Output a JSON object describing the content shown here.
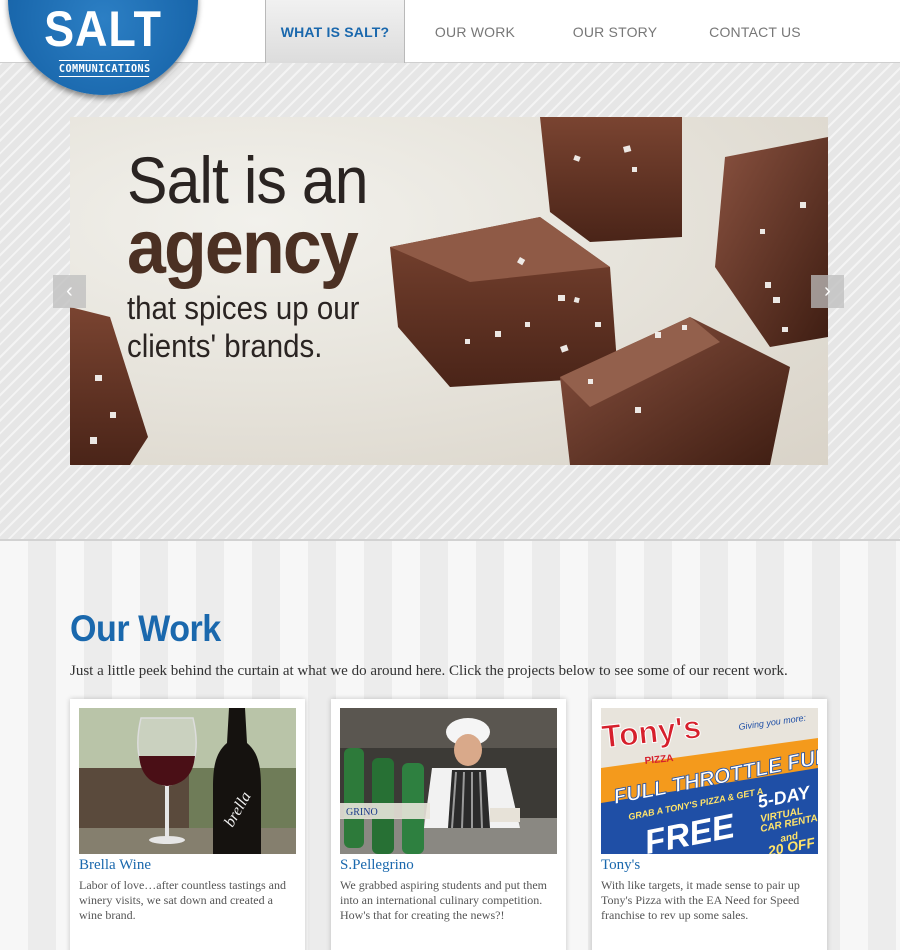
{
  "brand": {
    "name": "SALT",
    "sub": "COMMUNICATIONS",
    "color": "#1a68ad"
  },
  "nav": {
    "items": [
      {
        "label": "WHAT IS SALT?",
        "active": true
      },
      {
        "label": "OUR WORK",
        "active": false
      },
      {
        "label": "OUR STORY",
        "active": false
      },
      {
        "label": "CONTACT US",
        "active": false
      }
    ]
  },
  "hero": {
    "line1": "Salt is an",
    "line2": "agency",
    "line3": "that spices up our",
    "line4": "clients' brands.",
    "prev_icon": "chevron-left-icon",
    "next_icon": "chevron-right-icon"
  },
  "work": {
    "title": "Our Work",
    "intro": "Just a little peek behind the curtain at what we do around here. Click the projects below to see some of our recent work.",
    "cards": [
      {
        "title": "Brella Wine",
        "desc": "Labor of love…after countless tastings and winery visits, we sat down and created a wine brand."
      },
      {
        "title": "S.Pellegrino",
        "desc": "We grabbed aspiring students and put them into an international culinary competition. How's that for creating the news?!"
      },
      {
        "title": "Tony's",
        "desc": "With like targets, it made sense to pair up Tony's Pizza with the EA Need for Speed franchise to rev up some sales."
      }
    ],
    "tony_ad": {
      "logo": "Tony's",
      "logo_sub": "PIZZA",
      "tag": "Giving you more:",
      "headline": "FULL THROTTLE FUN!",
      "offer": "GRAB A TONY'S PIZZA & GET A",
      "big": "FREE",
      "detail1": "5-DAY",
      "detail2": "VIRTUAL",
      "detail3": "CAR RENTAL",
      "detail4": "and",
      "detail5": "20 OFF"
    },
    "pellegrino_label": "GRINO"
  }
}
